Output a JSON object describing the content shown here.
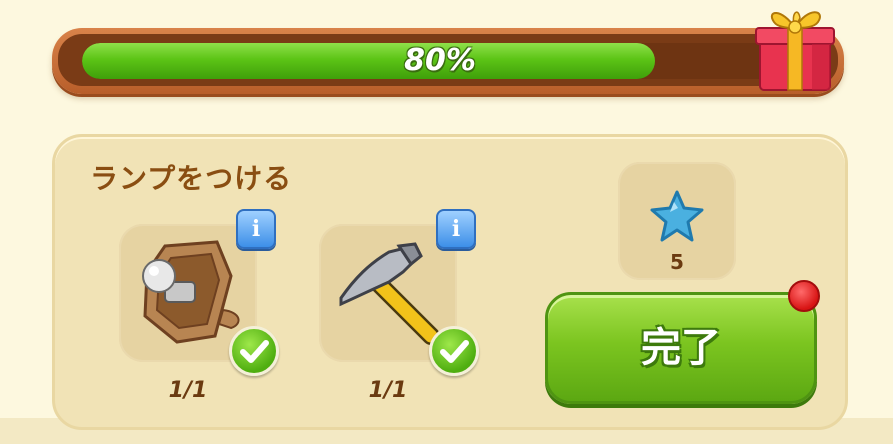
{
  "progress": {
    "value": 0.8,
    "label": "80%"
  },
  "task": {
    "title": "ランプをつける",
    "items": [
      {
        "icon": "lamp-bulb-icon",
        "count": "1/1",
        "completed": true
      },
      {
        "icon": "hammer-icon",
        "count": "1/1",
        "completed": true
      }
    ]
  },
  "reward": {
    "icon": "blue-star-icon",
    "amount": "5"
  },
  "complete_button": {
    "label": "完了"
  },
  "colors": {
    "accent_green": "#5cc416",
    "frame_brown": "#b85e2a",
    "notification_red": "#d81414"
  }
}
